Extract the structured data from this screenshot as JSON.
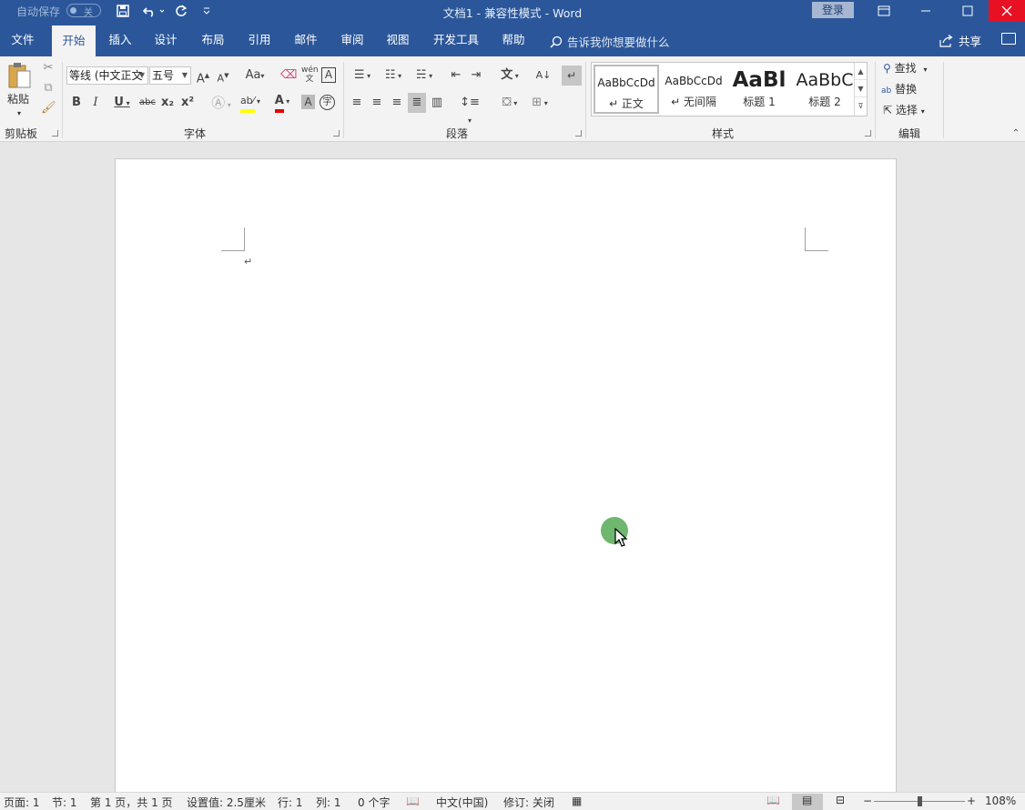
{
  "titlebar": {
    "autosave_label": "自动保存",
    "autosave_state": "关",
    "title": "文档1 - 兼容性模式 - Word",
    "login": "登录"
  },
  "tabs": [
    "文件",
    "开始",
    "插入",
    "设计",
    "布局",
    "引用",
    "邮件",
    "审阅",
    "视图",
    "开发工具",
    "帮助"
  ],
  "active_tab": "开始",
  "tell_me": "告诉我你想要做什么",
  "share": "共享",
  "ribbon": {
    "clipboard": {
      "paste": "粘贴",
      "label": "剪贴板"
    },
    "font": {
      "font_name": "等线 (中文正文",
      "font_size": "五号",
      "label": "字体",
      "grow": "A",
      "shrink": "A",
      "case": "Aa",
      "bold": "B",
      "italic": "I",
      "underline": "U",
      "strike": "abc",
      "subscript": "x₂",
      "superscript": "x²",
      "font_color": "A",
      "char_shade": "A",
      "char_border": "A",
      "enclose": "字",
      "phonetic": "wén"
    },
    "paragraph": {
      "label": "段落"
    },
    "styles": {
      "label": "样式",
      "items": [
        {
          "sample": "AaBbCcDd",
          "name": "↵ 正文"
        },
        {
          "sample": "AaBbCcDd",
          "name": "↵ 无间隔"
        },
        {
          "sample": "AaBl",
          "name": "标题 1"
        },
        {
          "sample": "AaBbC",
          "name": "标题 2"
        }
      ]
    },
    "editing": {
      "label": "编辑",
      "find": "查找",
      "replace": "替换",
      "select": "选择"
    }
  },
  "document": {
    "paragraph_mark": "↵"
  },
  "status": {
    "page": "页面: 1",
    "section": "节: 1",
    "page_of": "第 1 页，共 1 页",
    "setting": "设置值: 2.5厘米",
    "row": "行: 1",
    "col": "列: 1",
    "words": "0 个字",
    "language": "中文(中国)",
    "track": "修订: 关闭",
    "zoom": "108%"
  },
  "colors": {
    "brand": "#2b579a",
    "close": "#e81123",
    "cursor_highlight": "#5fae5f"
  }
}
